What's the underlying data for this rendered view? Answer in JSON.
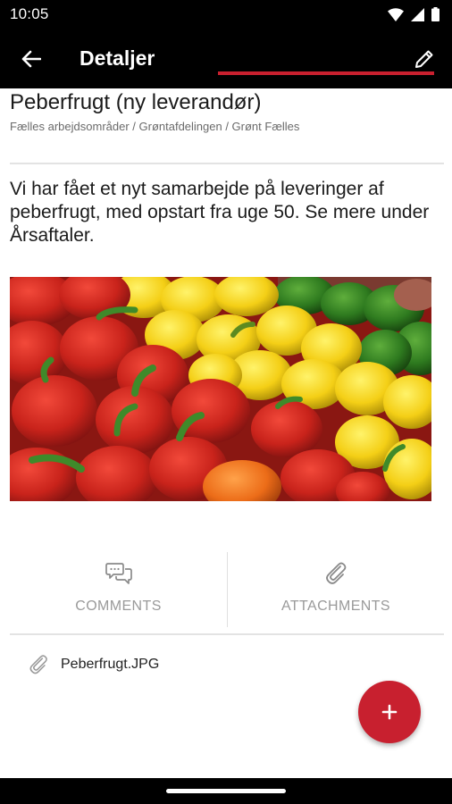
{
  "status_bar": {
    "time": "10:05"
  },
  "app_bar": {
    "title": "Detaljer",
    "back_icon": "arrow-left-icon",
    "edit_icon": "pencil-icon"
  },
  "item": {
    "title": "Peberfrugt (ny leverandør)",
    "breadcrumb": "Fælles arbejdsområder / Grøntafdelingen / Grønt Fælles",
    "description": "Vi har fået et nyt samarbejde på leveringer af peberfrugt, med opstart fra uge 50. Se mere under Årsaftaler."
  },
  "tabs": [
    {
      "label": "COMMENTS",
      "icon": "chat-bubbles-icon",
      "selected": false
    },
    {
      "label": "ATTACHMENTS",
      "icon": "paperclip-icon",
      "selected": true
    }
  ],
  "attachments": [
    {
      "name": "Peberfrugt.JPG",
      "icon": "paperclip-icon"
    }
  ],
  "fab": {
    "icon": "plus-icon"
  },
  "colors": {
    "accent": "#c8202f",
    "app_bar": "#000000",
    "tab_label": "#9a9a9a"
  }
}
